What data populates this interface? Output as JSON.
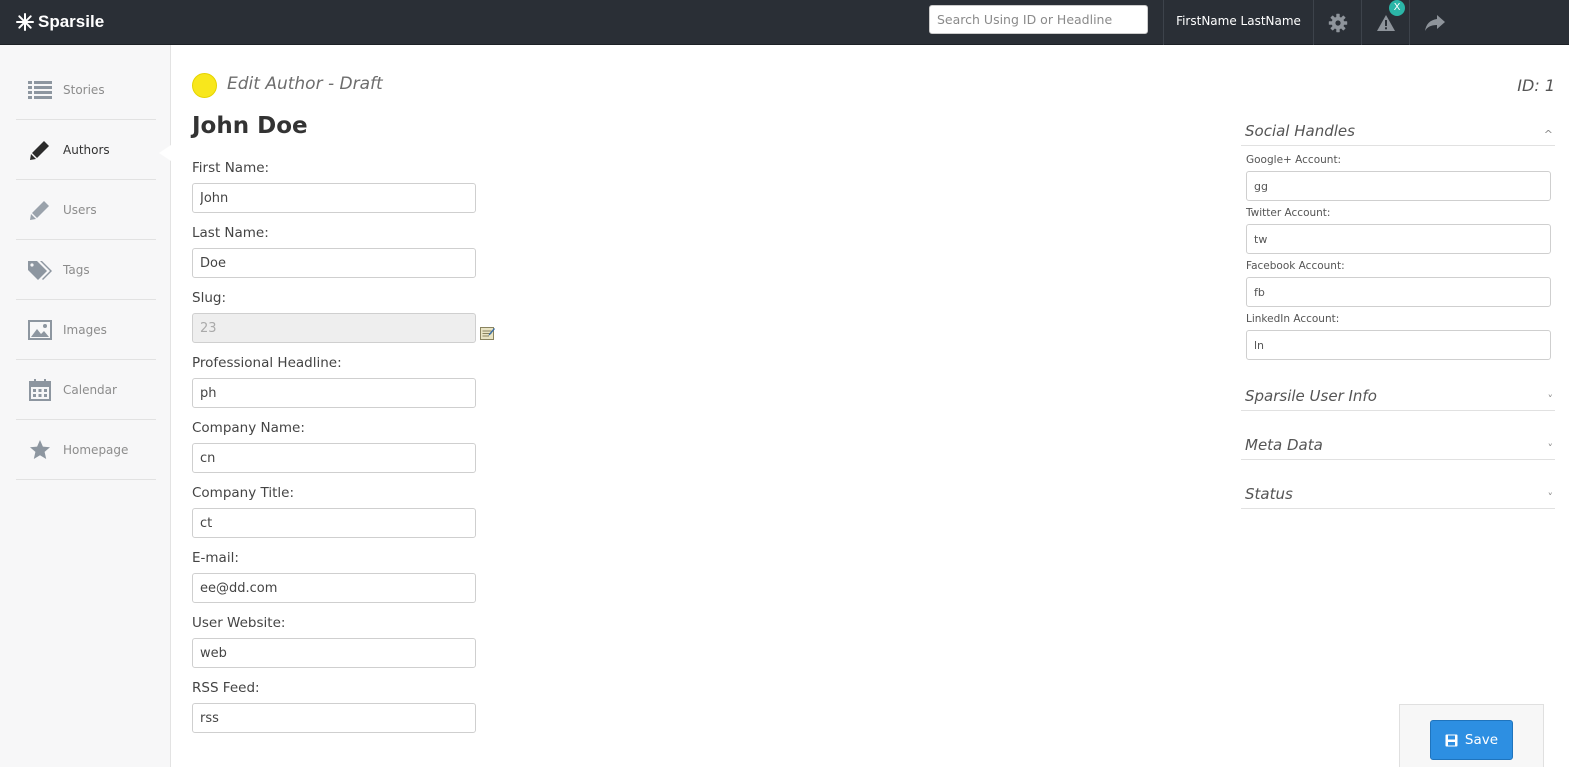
{
  "app": {
    "brand": "Sparsile"
  },
  "topbar": {
    "search_placeholder": "Search Using ID or Headline",
    "user_name": "FirstName LastName",
    "badge": "X"
  },
  "sidebar": {
    "items": [
      {
        "label": "Stories",
        "icon": "list-icon"
      },
      {
        "label": "Authors",
        "icon": "pencil-icon",
        "active": true
      },
      {
        "label": "Users",
        "icon": "pencil-icon"
      },
      {
        "label": "Tags",
        "icon": "tags-icon"
      },
      {
        "label": "Images",
        "icon": "image-icon"
      },
      {
        "label": "Calendar",
        "icon": "calendar-icon"
      },
      {
        "label": "Homepage",
        "icon": "star-icon"
      }
    ]
  },
  "header": {
    "title": "Edit Author - Draft",
    "id_label": "ID: 1",
    "name": "John Doe",
    "status_color": "#f8e71c"
  },
  "form": {
    "fields": [
      {
        "label": "First Name:",
        "value": "John"
      },
      {
        "label": "Last Name:",
        "value": "Doe"
      },
      {
        "label": "Slug:",
        "value": "23"
      },
      {
        "label": "Professional Headline:",
        "value": "ph"
      },
      {
        "label": "Company Name:",
        "value": "cn"
      },
      {
        "label": "Company Title:",
        "value": "ct"
      },
      {
        "label": "E-mail:",
        "value": "ee@dd.com"
      },
      {
        "label": "User Website:",
        "value": "web"
      },
      {
        "label": "RSS Feed:",
        "value": "rss"
      }
    ]
  },
  "panel": {
    "sections": [
      {
        "title": "Social Handles",
        "chevron": "^"
      },
      {
        "title": "Sparsile User Info",
        "chevron": "˅"
      },
      {
        "title": "Meta Data",
        "chevron": "˅"
      },
      {
        "title": "Status",
        "chevron": "˅"
      }
    ],
    "social": [
      {
        "label": "Google+ Account:",
        "value": "gg"
      },
      {
        "label": "Twitter Account:",
        "value": "tw"
      },
      {
        "label": "Facebook Account:",
        "value": "fb"
      },
      {
        "label": "LinkedIn Account:",
        "value": "ln"
      }
    ]
  },
  "actions": {
    "save_label": "Save",
    "accent": "#2d8fe2"
  }
}
